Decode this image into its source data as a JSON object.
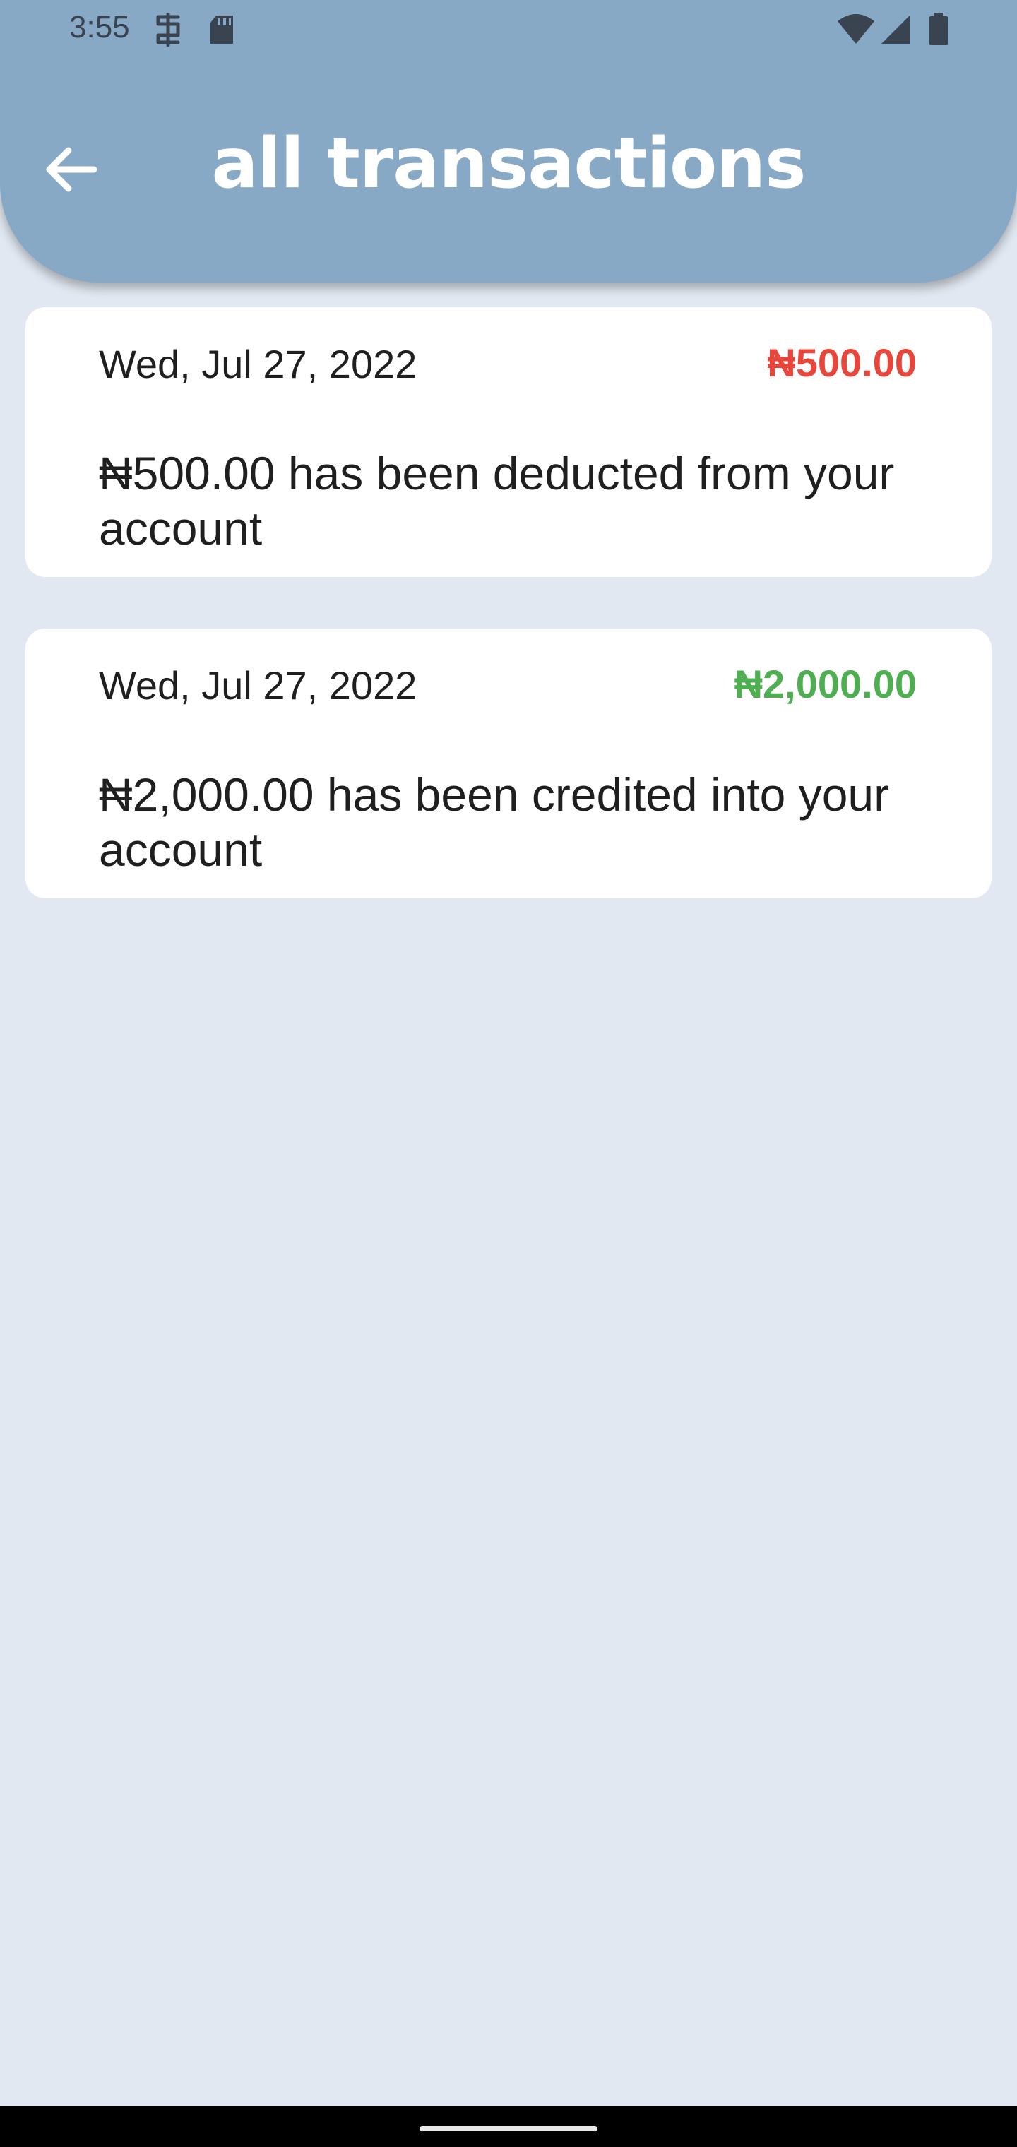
{
  "status_bar": {
    "time": "3:55",
    "icons": [
      "sim-icon",
      "sd-card-icon",
      "wifi-icon",
      "cell-signal-icon",
      "battery-icon"
    ]
  },
  "header": {
    "title": "all transactions",
    "back_icon": "arrow-left-icon",
    "background_color": "#87a9c6"
  },
  "transactions": [
    {
      "date": "Wed, Jul 27, 2022",
      "amount": "₦500.00",
      "type": "debit",
      "amount_color": "#e8463a",
      "message": "₦500.00 has been deducted from your account"
    },
    {
      "date": "Wed, Jul 27, 2022",
      "amount": "₦2,000.00",
      "type": "credit",
      "amount_color": "#4fae52",
      "message": "₦2,000.00 has been credited into your account"
    }
  ],
  "colors": {
    "page_background": "#e1e8f1",
    "card_background": "#ffffff",
    "debit": "#e8463a",
    "credit": "#4fae52"
  }
}
